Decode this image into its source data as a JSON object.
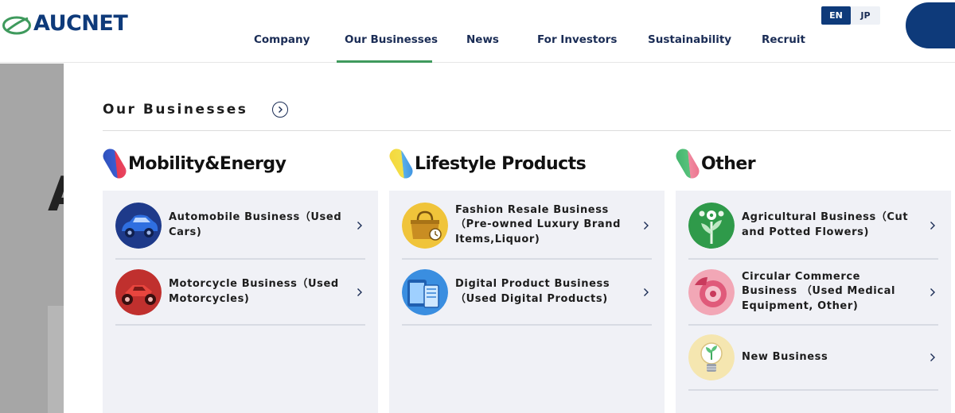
{
  "brand": {
    "name": "AUCNET",
    "color": "#0e3a7a",
    "accent_green": "#3f9a5d"
  },
  "nav": {
    "items": [
      {
        "label": "Company"
      },
      {
        "label": "Our Businesses",
        "active": true
      },
      {
        "label": "News"
      },
      {
        "label": "For Investors"
      },
      {
        "label": "Sustainability"
      },
      {
        "label": "Recruit"
      }
    ]
  },
  "lang": {
    "en": "EN",
    "jp": "JP",
    "selected": "EN"
  },
  "backdrop": {
    "glyph": "A"
  },
  "menu": {
    "title": "Our Businesses",
    "categories": [
      {
        "title": "Mobility&Energy",
        "icon": "capsule-red-blue-icon",
        "items": [
          {
            "label": "Automobile Business（Used Cars)",
            "icon": "car-icon"
          },
          {
            "label": "Motorcycle Business（Used Motorcycles)",
            "icon": "motorcycle-icon"
          }
        ]
      },
      {
        "title": "Lifestyle Products",
        "icon": "capsule-yellow-blue-icon",
        "items": [
          {
            "label": "Fashion Resale Business（Pre-owned Luxury Brand Items,Liquor)",
            "icon": "handbag-icon"
          },
          {
            "label": "Digital Product Business （Used Digital Products)",
            "icon": "devices-icon"
          }
        ]
      },
      {
        "title": "Other",
        "icon": "capsule-green-pink-icon",
        "items": [
          {
            "label": "Agricultural Business（Cut and Potted Flowers)",
            "icon": "flower-icon"
          },
          {
            "label": "Circular Commerce Business （Used Medical Equipment, Other)",
            "icon": "medical-equipment-icon"
          },
          {
            "label": "New Business",
            "icon": "lightbulb-sprout-icon"
          }
        ]
      }
    ]
  }
}
